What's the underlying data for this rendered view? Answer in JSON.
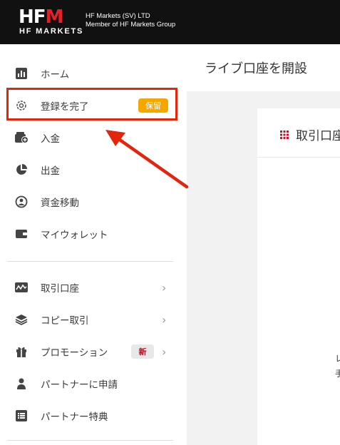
{
  "header": {
    "logo_main": "HF",
    "logo_m": "M",
    "logo_sub": "HF MARKETS",
    "company_line1": "HF Markets (SV) LTD",
    "company_line2": "Member of HF Markets Group"
  },
  "sidebar": {
    "items": [
      {
        "label": "ホーム",
        "icon": "bar-chart-icon"
      },
      {
        "label": "登録を完了",
        "icon": "gear-icon",
        "badge": "保留"
      },
      {
        "label": "入金",
        "icon": "wallet-plus-icon"
      },
      {
        "label": "出金",
        "icon": "pie-chart-icon"
      },
      {
        "label": "資金移動",
        "icon": "transfer-icon"
      },
      {
        "label": "マイウォレット",
        "icon": "wallet-icon"
      },
      {
        "label": "取引口座",
        "icon": "trading-chart-icon"
      },
      {
        "label": "コピー取引",
        "icon": "layers-icon"
      },
      {
        "label": "プロモーション",
        "icon": "gift-icon",
        "badge": "新"
      },
      {
        "label": "パートナーに申請",
        "icon": "person-icon"
      },
      {
        "label": "パートナー特典",
        "icon": "list-icon"
      }
    ]
  },
  "main": {
    "page_title": "ライブ口座を開設",
    "card_title": "取引口座",
    "card_fragment_1": "レ",
    "card_fragment_2": "手"
  },
  "colors": {
    "topbar": "#111111",
    "brand_red": "#e2212b",
    "highlight": "#e2250c",
    "badge_hold": "#f5a700",
    "badge_new_text": "#d0021b"
  }
}
